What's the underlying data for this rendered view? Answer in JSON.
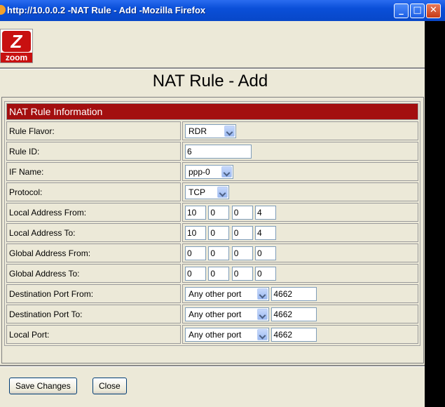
{
  "window": {
    "title": "http://10.0.0.2 -NAT Rule - Add -Mozilla Firefox"
  },
  "logo": {
    "mark": "Z",
    "word": "zoom"
  },
  "page": {
    "title": "NAT Rule - Add"
  },
  "section": {
    "title": "NAT Rule Information"
  },
  "fields": {
    "rule_flavor": {
      "label": "Rule Flavor:",
      "value": "RDR"
    },
    "rule_id": {
      "label": "Rule ID:",
      "value": "6"
    },
    "if_name": {
      "label": "IF Name:",
      "value": "ppp-0"
    },
    "protocol": {
      "label": "Protocol:",
      "value": "TCP"
    },
    "local_from": {
      "label": "Local Address From:",
      "octets": [
        "10",
        "0",
        "0",
        "4"
      ]
    },
    "local_to": {
      "label": "Local Address To:",
      "octets": [
        "10",
        "0",
        "0",
        "4"
      ]
    },
    "global_from": {
      "label": "Global Address From:",
      "octets": [
        "0",
        "0",
        "0",
        "0"
      ]
    },
    "global_to": {
      "label": "Global Address To:",
      "octets": [
        "0",
        "0",
        "0",
        "0"
      ]
    },
    "dest_port_from": {
      "label": "Destination Port From:",
      "option": "Any other port",
      "value": "4662"
    },
    "dest_port_to": {
      "label": "Destination Port To:",
      "option": "Any other port",
      "value": "4662"
    },
    "local_port": {
      "label": "Local Port:",
      "option": "Any other port",
      "value": "4662"
    }
  },
  "buttons": {
    "save": "Save Changes",
    "close": "Close"
  },
  "colors": {
    "section_bg": "#a30f0f",
    "titlebar": "#0a4fd8",
    "logo_red": "#c81010"
  }
}
